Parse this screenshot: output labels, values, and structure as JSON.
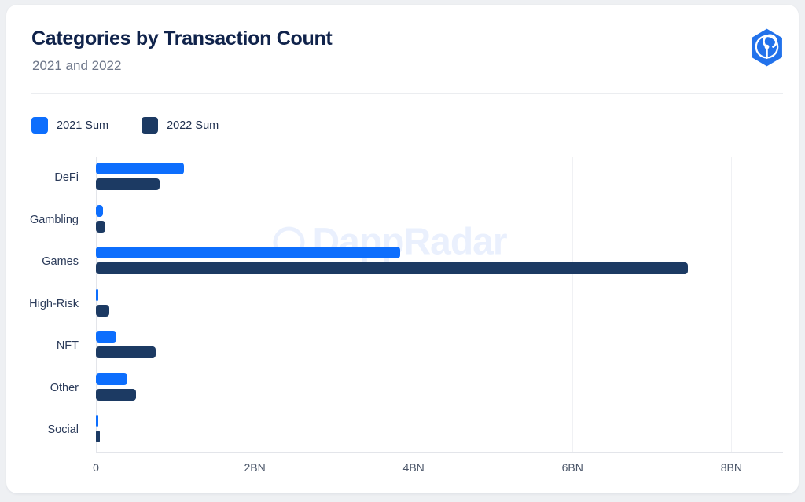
{
  "card": {
    "title": "Categories by Transaction Count",
    "subtitle": "2021 and 2022",
    "logo_icon": "dappradar-hexagon-logo",
    "watermark_text": "DappRadar"
  },
  "legend": {
    "items": [
      {
        "label": "2021 Sum",
        "color": "#0d6efd"
      },
      {
        "label": "2022 Sum",
        "color": "#1c3a63"
      }
    ]
  },
  "colors": {
    "series_2021": "#0d6efd",
    "series_2022": "#1c3a63",
    "title": "#10234b",
    "subtitle": "#6d7689",
    "card_background": "#ffffff",
    "page_background": "#eef0f3",
    "gridline": "#f0f1f4",
    "watermark": "#eaf0fd",
    "brand": "#2272eb"
  },
  "chart_data": {
    "type": "bar",
    "orientation": "horizontal",
    "title": "Categories by Transaction Count",
    "subtitle": "2021 and 2022",
    "xlabel": "",
    "ylabel": "",
    "xlim": [
      0,
      8.65
    ],
    "grid": true,
    "legend_position": "top-left",
    "unit": "BN",
    "xticks": [
      0,
      2,
      4,
      6,
      8
    ],
    "xticklabels": [
      "0",
      "2BN",
      "4BN",
      "6BN",
      "8BN"
    ],
    "categories": [
      "DeFi",
      "Gambling",
      "Games",
      "High-Risk",
      "NFT",
      "Other",
      "Social"
    ],
    "series": [
      {
        "name": "2021 Sum",
        "color": "#0d6efd",
        "values": [
          1.11,
          0.09,
          3.83,
          0.02,
          0.26,
          0.4,
          0.02
        ]
      },
      {
        "name": "2022 Sum",
        "color": "#1c3a63",
        "values": [
          0.8,
          0.12,
          7.45,
          0.17,
          0.75,
          0.5,
          0.05
        ]
      }
    ]
  }
}
